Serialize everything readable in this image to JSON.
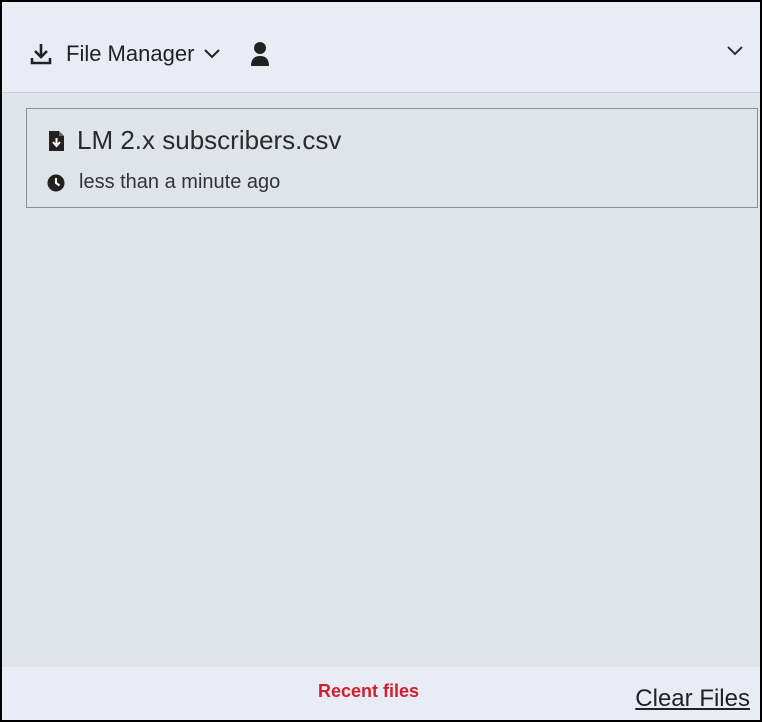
{
  "header": {
    "title": "File Manager",
    "icons": {
      "download": "download-icon",
      "title_chevron": "chevron-down-icon",
      "user": "user-icon",
      "collapse": "chevron-down-icon"
    }
  },
  "files": [
    {
      "name": "LM 2.x subscribers.csv",
      "time": "less than a minute ago",
      "file_icon": "file-download-icon",
      "time_icon": "clock-icon"
    }
  ],
  "footer": {
    "recent_label": "Recent files",
    "clear_label": "Clear Files"
  },
  "colors": {
    "panel_bg": "#dfe3ea",
    "header_bg": "#e9ecf4",
    "accent_red": "#d0202e",
    "text": "#222222"
  }
}
